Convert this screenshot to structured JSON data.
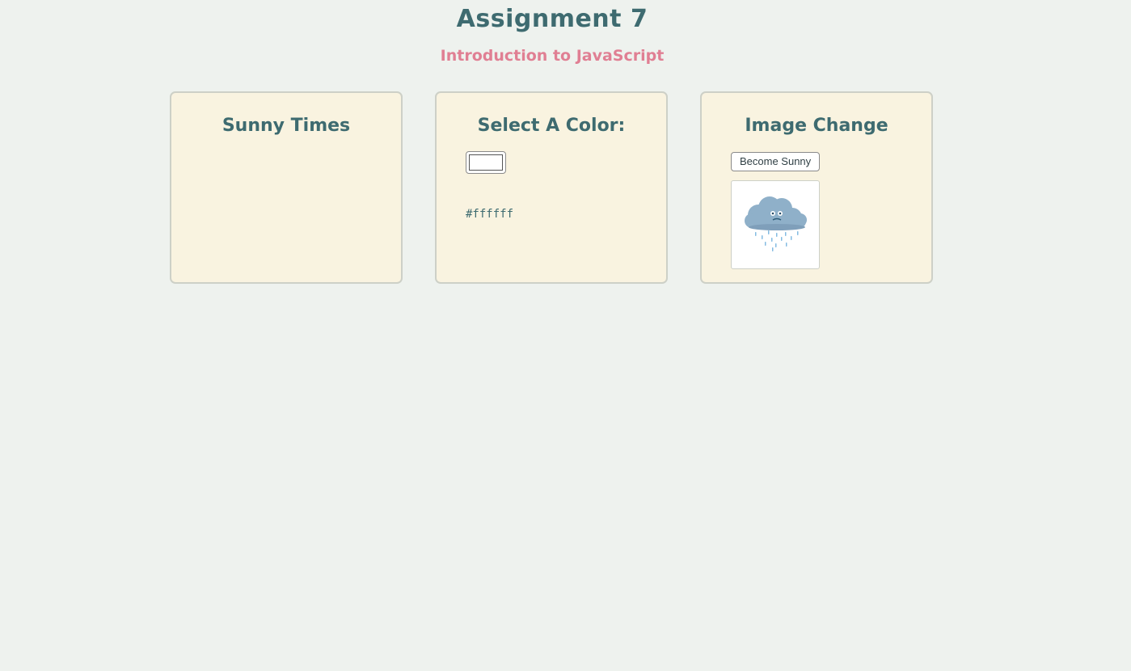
{
  "header": {
    "title": "Assignment 7",
    "subtitle": "Introduction to JavaScript"
  },
  "cards": [
    {
      "title": "Sunny Times"
    },
    {
      "title": "Select A Color:",
      "color_value": "#ffffff"
    },
    {
      "title": "Image Change",
      "button_label": "Become Sunny",
      "image": "rain-cloud-icon"
    }
  ],
  "colors": {
    "background": "#eef2ee",
    "card": "#f9f3e0",
    "heading": "#3e6b70",
    "subtitle": "#e07f93",
    "selected_color": "#ffffff"
  }
}
